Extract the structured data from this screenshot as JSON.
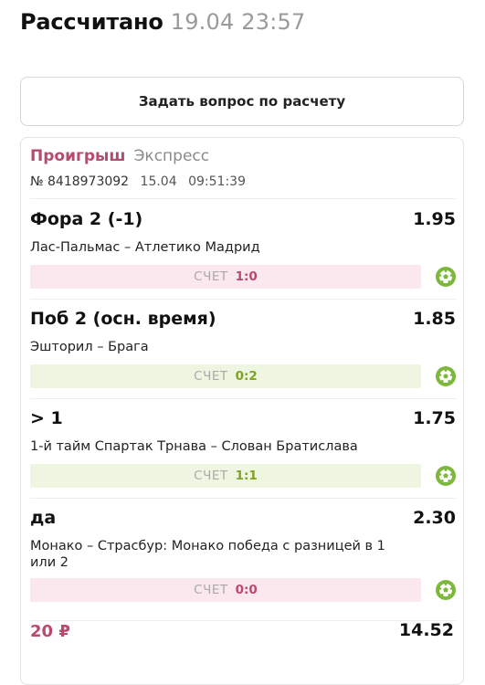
{
  "header": {
    "status": "Рассчитано",
    "timestamp": "19.04 23:57"
  },
  "ask_button": {
    "label": "Задать вопрос по расчету"
  },
  "bet": {
    "result": "Проигрыш",
    "type": "Экспресс",
    "number": "№ 8418973092",
    "date": "15.04",
    "time": "09:51:39",
    "stake": "20 ₽",
    "total_odds": "14.52",
    "events": [
      {
        "title": "Фора 2 (-1)",
        "odds": "1.95",
        "teams": "Лас-Пальмас – Атлетико Мадрид",
        "score_label": "СЧЕТ",
        "score": "1:0",
        "outcome": "lost",
        "sport_icon": "soccer-ball-icon"
      },
      {
        "title": "Поб 2 (осн. время)",
        "odds": "1.85",
        "teams": "Эшторил – Брага",
        "score_label": "СЧЕТ",
        "score": "0:2",
        "outcome": "won",
        "sport_icon": "soccer-ball-icon"
      },
      {
        "title": "> 1",
        "odds": "1.75",
        "teams": "1-й тайм Спартак Трнава – Слован Братислава",
        "score_label": "СЧЕТ",
        "score": "1:1",
        "outcome": "won",
        "sport_icon": "soccer-ball-icon"
      },
      {
        "title": "да",
        "odds": "2.30",
        "teams": "Монако – Страсбур: Монако победа с разницей в 1 или 2",
        "score_label": "СЧЕТ",
        "score": "0:0",
        "outcome": "lost",
        "sport_icon": "soccer-ball-icon"
      }
    ]
  },
  "colors": {
    "lost": "#b94a6e",
    "won": "#7da326",
    "lost_bg": "#fbe7ee",
    "won_bg": "#eef5e1",
    "ball": "#7db83c"
  }
}
